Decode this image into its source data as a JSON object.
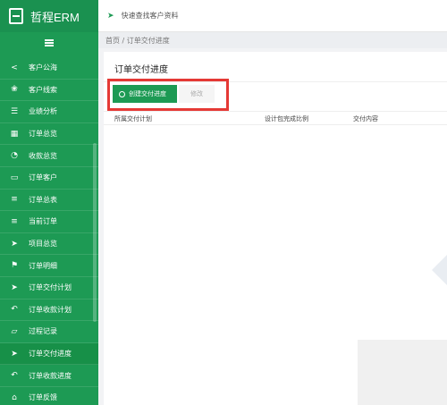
{
  "sidebar": {
    "brand": "哲程ERM",
    "items": [
      {
        "icon": "share-icon",
        "glyph": "<",
        "label": "客户公海"
      },
      {
        "icon": "lightbulb-icon",
        "glyph": "❀",
        "label": "客户线索"
      },
      {
        "icon": "list-icon",
        "glyph": "☰",
        "label": "业绩分析"
      },
      {
        "icon": "grid-icon",
        "glyph": "▦",
        "label": "订单总览"
      },
      {
        "icon": "rss-icon",
        "glyph": "◔",
        "label": "收款总览"
      },
      {
        "icon": "monitor-icon",
        "glyph": "▭",
        "label": "订单客户"
      },
      {
        "icon": "server-icon",
        "glyph": "≡",
        "label": "订单总表"
      },
      {
        "icon": "menu-icon",
        "glyph": "≡",
        "label": "当前订单"
      },
      {
        "icon": "send-icon",
        "glyph": "➤",
        "label": "项目总览"
      },
      {
        "icon": "flag-icon",
        "glyph": "⚑",
        "label": "订单明细"
      },
      {
        "icon": "send-icon",
        "glyph": "➤",
        "label": "订单交付计划"
      },
      {
        "icon": "reply-icon",
        "glyph": "↶",
        "label": "订单收款计划"
      },
      {
        "icon": "folder-icon",
        "glyph": "▱",
        "label": "过程记录"
      },
      {
        "icon": "send-icon",
        "glyph": "➤",
        "label": "订单交付进度"
      },
      {
        "icon": "reply-icon",
        "glyph": "↶",
        "label": "订单收款进度"
      },
      {
        "icon": "bell-icon",
        "glyph": "⌂",
        "label": "订单反馈"
      }
    ],
    "active_index": 13
  },
  "topbar": {
    "quick_search": "快速查找客户资料"
  },
  "breadcrumb": "首页 / 订单交付进度",
  "panel": {
    "title": "订单交付进度",
    "create_button": "创建交付进度",
    "edit_button": "修改",
    "columns": [
      "所属交付计划",
      "设计包完成比例",
      "交付内容"
    ]
  },
  "colors": {
    "brand_green": "#1d9a54",
    "highlight_red": "#e53935"
  }
}
